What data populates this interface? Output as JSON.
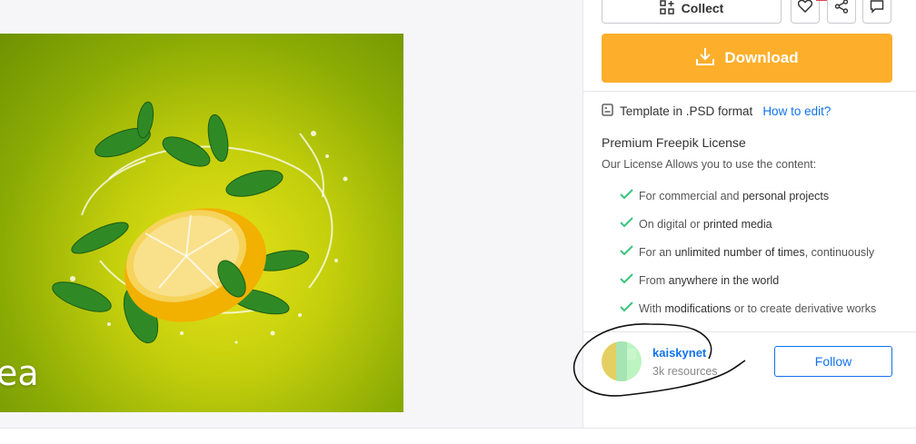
{
  "preview": {
    "title_fragment": "ea"
  },
  "actions": {
    "collect_label": "Collect",
    "download_label": "Download"
  },
  "file_info": {
    "format_text": "Template in .PSD format",
    "how_to_edit": "How to edit?"
  },
  "license": {
    "title": "Premium Freepik License",
    "subtitle": "Our License Allows you to use the content:",
    "items": [
      {
        "pre": "For commercial and ",
        "bold": "personal projects",
        "post": ""
      },
      {
        "pre": "On digital or ",
        "bold": "printed media",
        "post": ""
      },
      {
        "pre": "For an ",
        "bold": "unlimited number of times",
        "post": ", continuously"
      },
      {
        "pre": "From ",
        "bold": "anywhere in the world",
        "post": ""
      },
      {
        "pre": "With ",
        "bold": "modifications",
        "post": " or to create derivative works"
      }
    ]
  },
  "author": {
    "name": "kaiskynet",
    "resources": "3k resources",
    "follow_label": "Follow"
  },
  "colors": {
    "download": "#fdaf2b",
    "link": "#1273eb",
    "check": "#3ac47d"
  },
  "icons": [
    "collect-icon",
    "heart-icon",
    "share-icon",
    "comment-icon",
    "download-icon",
    "file-psd-icon",
    "check-icon"
  ]
}
